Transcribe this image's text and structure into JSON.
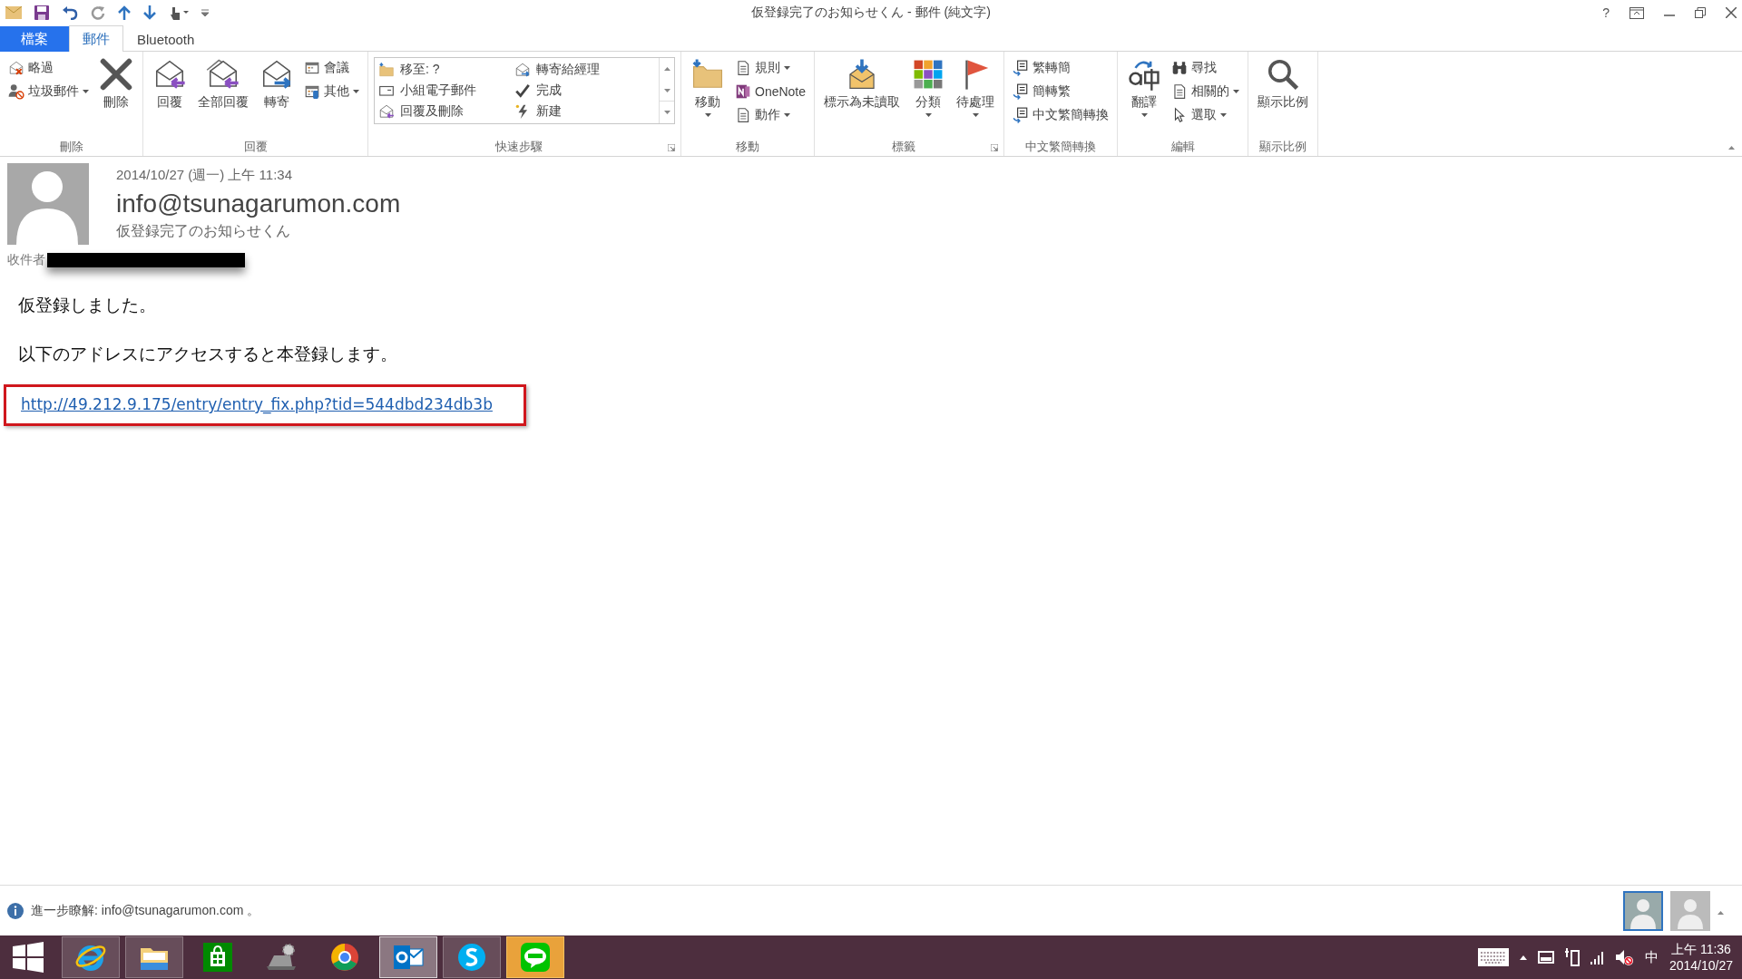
{
  "window": {
    "title": "仮登録完了のお知らせくん - 郵件 (純文字)",
    "help": "?"
  },
  "tabs": [
    {
      "label": "檔案",
      "kind": "file",
      "selected": false
    },
    {
      "label": "郵件",
      "kind": "tab",
      "selected": true
    },
    {
      "label": "Bluetooth",
      "kind": "tab",
      "selected": false
    }
  ],
  "ribbon": {
    "groups": [
      {
        "label": "刪除",
        "launcher": false,
        "items": [
          {
            "label": "略過",
            "kind": "small",
            "dropdown": false
          },
          {
            "label": "垃圾郵件",
            "kind": "small",
            "dropdown": true
          },
          {
            "label": "刪除",
            "kind": "large",
            "dropdown": false
          }
        ]
      },
      {
        "label": "回覆",
        "launcher": false,
        "items": [
          {
            "label": "回覆",
            "kind": "large",
            "dropdown": false
          },
          {
            "label": "全部回覆",
            "kind": "large",
            "dropdown": false
          },
          {
            "label": "轉寄",
            "kind": "large",
            "dropdown": false
          },
          {
            "label": "會議",
            "kind": "small",
            "dropdown": false
          },
          {
            "label": "其他",
            "kind": "small",
            "dropdown": true
          }
        ]
      },
      {
        "label": "快速步驟",
        "launcher": true,
        "items": [
          {
            "kind": "gallery",
            "entries": [
              {
                "label": "移至: ?"
              },
              {
                "label": "轉寄給經理"
              },
              {
                "label": "小組電子郵件"
              },
              {
                "label": "完成"
              },
              {
                "label": "回覆及刪除"
              },
              {
                "label": "新建"
              }
            ]
          }
        ]
      },
      {
        "label": "移動",
        "launcher": false,
        "items": [
          {
            "label": "移動",
            "kind": "large",
            "dropdown": true
          },
          {
            "label": "規則",
            "kind": "small",
            "dropdown": true
          },
          {
            "label": "OneNote",
            "kind": "small",
            "dropdown": false
          },
          {
            "label": "動作",
            "kind": "small",
            "dropdown": true
          }
        ]
      },
      {
        "label": "標籤",
        "launcher": true,
        "items": [
          {
            "label": "標示為未讀取",
            "kind": "large",
            "dropdown": false
          },
          {
            "label": "分類",
            "kind": "large",
            "dropdown": true
          },
          {
            "label": "待處理",
            "kind": "large",
            "dropdown": true
          }
        ]
      },
      {
        "label": "中文繁簡轉換",
        "launcher": false,
        "items": [
          {
            "label": "繁轉簡",
            "kind": "small",
            "dropdown": false
          },
          {
            "label": "簡轉繁",
            "kind": "small",
            "dropdown": false
          },
          {
            "label": "中文繁簡轉換",
            "kind": "small",
            "dropdown": false
          }
        ]
      },
      {
        "label": "編輯",
        "launcher": false,
        "items": [
          {
            "label": "翻譯",
            "kind": "large",
            "dropdown": true
          },
          {
            "label": "尋找",
            "kind": "small",
            "dropdown": false
          },
          {
            "label": "相關的",
            "kind": "small",
            "dropdown": true
          },
          {
            "label": "選取",
            "kind": "small",
            "dropdown": true
          }
        ]
      },
      {
        "label": "顯示比例",
        "launcher": false,
        "items": [
          {
            "label": "顯示比例",
            "kind": "large",
            "dropdown": false
          }
        ]
      }
    ]
  },
  "message": {
    "date": "2014/10/27 (週一) 上午 11:34",
    "sender": "info@tsunagarumon.com",
    "subject": "仮登録完了のお知らせくん",
    "to_label": "收件者",
    "body": [
      {
        "kind": "text",
        "text": "仮登録しました。"
      },
      {
        "kind": "text",
        "text": "以下のアドレスにアクセスすると本登録します。"
      },
      {
        "kind": "link",
        "text": "http://49.212.9.175/entry/entry_fix.php?tid=544dbd234db3b",
        "highlighted": true
      }
    ]
  },
  "info_bar": {
    "text": "進一步瞭解: info@tsunagarumon.com 。"
  },
  "people_pane": [
    {
      "selected": true
    },
    {
      "selected": false
    }
  ],
  "taskbar": {
    "apps": [
      {
        "running": true,
        "selected": false,
        "flashing": false
      },
      {
        "running": true,
        "selected": false,
        "flashing": false
      },
      {
        "running": false,
        "selected": false,
        "flashing": false
      },
      {
        "running": false,
        "selected": false,
        "flashing": false
      },
      {
        "running": false,
        "selected": false,
        "flashing": false
      },
      {
        "running": true,
        "selected": true,
        "flashing": false
      },
      {
        "running": true,
        "selected": false,
        "flashing": false
      },
      {
        "running": true,
        "selected": false,
        "flashing": true
      }
    ],
    "ime": "中",
    "time": "上午 11:36",
    "date": "2014/10/27"
  }
}
